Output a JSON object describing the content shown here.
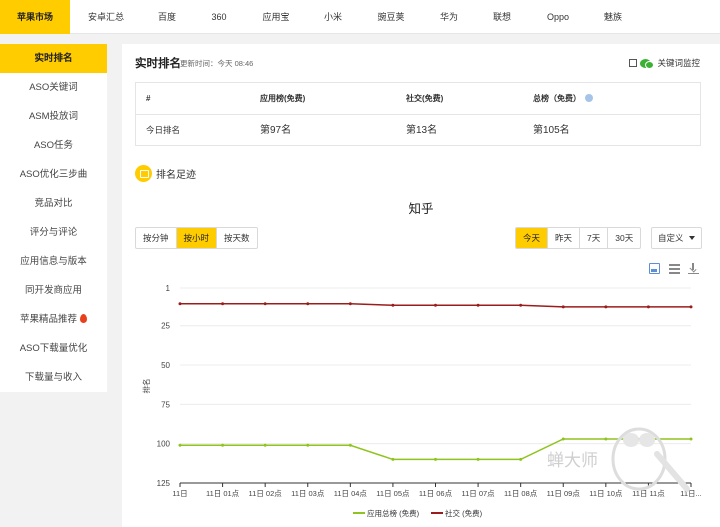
{
  "topnav": {
    "tabs": [
      {
        "label": "苹果市场",
        "active": true
      },
      {
        "label": "安卓汇总"
      },
      {
        "label": "百度"
      },
      {
        "label": "360"
      },
      {
        "label": "应用宝"
      },
      {
        "label": "小米"
      },
      {
        "label": "豌豆荚"
      },
      {
        "label": "华为"
      },
      {
        "label": "联想"
      },
      {
        "label": "Oppo"
      },
      {
        "label": "魅族"
      }
    ]
  },
  "sidebar": {
    "items": [
      {
        "label": "实时排名",
        "active": true
      },
      {
        "label": "ASO关键词"
      },
      {
        "label": "ASM投放词"
      },
      {
        "label": "ASO任务"
      },
      {
        "label": "ASO优化三步曲"
      },
      {
        "label": "竞品对比"
      },
      {
        "label": "评分与评论"
      },
      {
        "label": "应用信息与版本"
      },
      {
        "label": "同开发商应用"
      },
      {
        "label": "苹果精品推荐",
        "hot": true
      },
      {
        "label": "ASO下载量优化"
      },
      {
        "label": "下载量与收入"
      }
    ]
  },
  "header": {
    "title": "实时排名",
    "update_time": "更新时间：今天 08:46",
    "monitor_label": "关键词监控"
  },
  "rank_table": {
    "headers": [
      "#",
      "应用榜(免费)",
      "社交(免费)",
      "总榜（免费）"
    ],
    "row": [
      "今日排名",
      "第97名",
      "第13名",
      "第105名"
    ]
  },
  "footprint": {
    "label": "排名足迹"
  },
  "granularity": {
    "buttons": [
      "按分钟",
      "按小时",
      "按天数"
    ],
    "selected": "按小时"
  },
  "range": {
    "buttons": [
      "今天",
      "昨天",
      "7天",
      "30天"
    ],
    "selected": "今天",
    "custom_label": "自定义"
  },
  "watermark": {
    "text": "蝉大师"
  },
  "chart_data": {
    "type": "line",
    "title": "知乎",
    "ylabel": "排名",
    "y_reversed": true,
    "ylim": [
      1,
      125
    ],
    "yticks": [
      1,
      25,
      50,
      75,
      100,
      125
    ],
    "categories": [
      "11日",
      "11日 01点",
      "11日 02点",
      "11日 03点",
      "11日 04点",
      "11日 05点",
      "11日 06点",
      "11日 07点",
      "11日 08点",
      "11日 09点",
      "11日 10点",
      "11日 11点",
      "11日..."
    ],
    "series": [
      {
        "name": "应用总榜 (免费)",
        "color": "#8fc31f",
        "values": [
          101,
          101,
          101,
          101,
          101,
          110,
          110,
          110,
          110,
          97,
          97,
          97,
          97
        ]
      },
      {
        "name": "社交 (免费)",
        "color": "#9b1c1c",
        "values": [
          11,
          11,
          11,
          11,
          11,
          12,
          12,
          12,
          12,
          13,
          13,
          13,
          13
        ]
      }
    ],
    "legend_position": "bottom",
    "grid": true
  }
}
